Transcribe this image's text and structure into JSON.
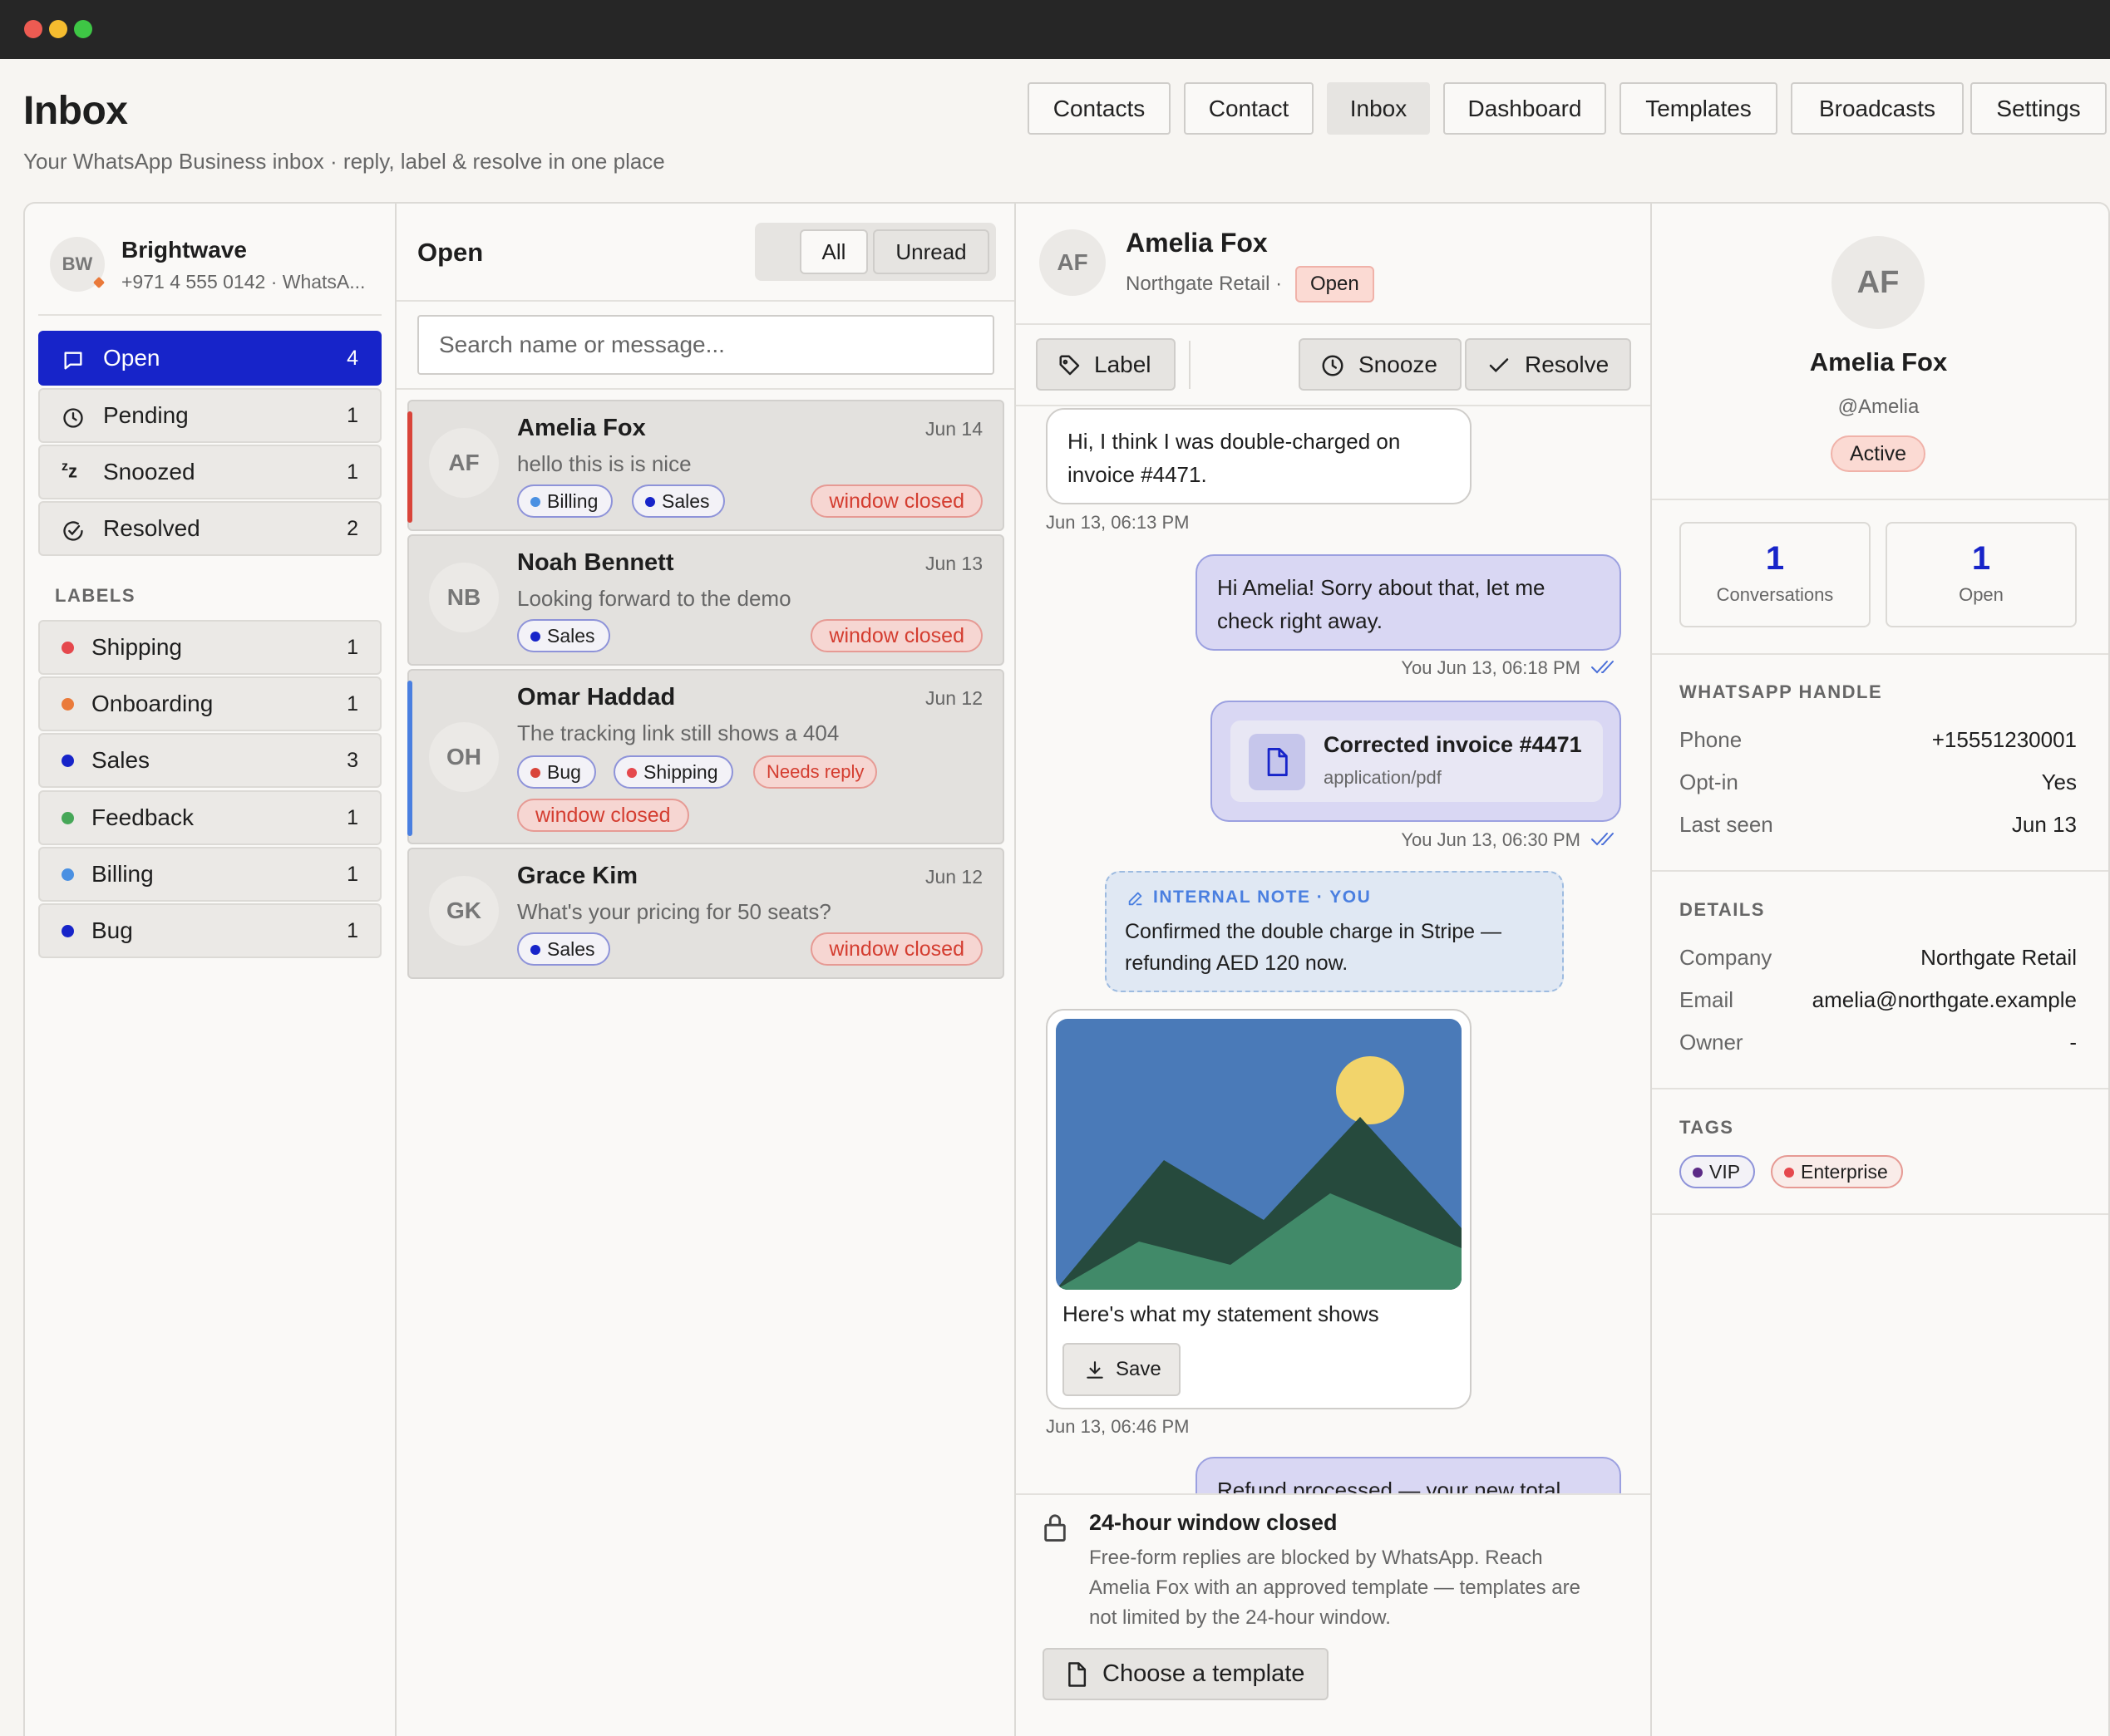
{
  "window": {
    "traffic": [
      "#ed5b52",
      "#f5bc2f",
      "#3ec645"
    ]
  },
  "header": {
    "title": "Inbox",
    "subtitle": "Your WhatsApp Business inbox · reply, label & resolve in one place",
    "nav": [
      "Contacts",
      "Contact",
      "Inbox",
      "Dashboard",
      "Templates",
      "Broadcasts",
      "Settings"
    ],
    "active_nav": "Inbox"
  },
  "account": {
    "initials": "BW",
    "name": "Brightwave",
    "phone": "+971 4 555 0142 · WhatsA..."
  },
  "sidebar": {
    "statuses": [
      {
        "label": "Open",
        "count": "4",
        "icon": "chat-bubble-icon"
      },
      {
        "label": "Pending",
        "count": "1",
        "icon": "clock-icon"
      },
      {
        "label": "Snoozed",
        "count": "1",
        "icon": "snooze-icon"
      },
      {
        "label": "Resolved",
        "count": "2",
        "icon": "check-circle-icon"
      }
    ],
    "labels_heading": "LABELS",
    "labels": [
      {
        "label": "Shipping",
        "count": "1",
        "color": "#e5484d"
      },
      {
        "label": "Onboarding",
        "count": "1",
        "color": "#ea7a3a"
      },
      {
        "label": "Sales",
        "count": "3",
        "color": "#1724c9"
      },
      {
        "label": "Feedback",
        "count": "1",
        "color": "#46a758"
      },
      {
        "label": "Billing",
        "count": "1",
        "color": "#4a90e2"
      },
      {
        "label": "Bug",
        "count": "1",
        "color": "#1724c9"
      }
    ]
  },
  "list": {
    "title": "Open",
    "filters": [
      "All",
      "Unread"
    ],
    "search_placeholder": "Search name or message...",
    "window_closed": "window closed",
    "needs_reply": "Needs reply",
    "conversations": [
      {
        "initials": "AF",
        "name": "Amelia Fox",
        "date": "Jun 14",
        "preview": "hello this is is nice",
        "tags": [
          "Billing",
          "Sales"
        ],
        "accent": "#d9443a"
      },
      {
        "initials": "NB",
        "name": "Noah Bennett",
        "date": "Jun 13",
        "preview": "Looking forward to the demo",
        "tags": [
          "Sales"
        ]
      },
      {
        "initials": "OH",
        "name": "Omar Haddad",
        "date": "Jun 12",
        "preview": "The tracking link still shows a 404",
        "tags": [
          "Bug",
          "Shipping"
        ],
        "accent": "#4a7fe0"
      },
      {
        "initials": "GK",
        "name": "Grace Kim",
        "date": "Jun 12",
        "preview": "What's your pricing for 50 seats?",
        "tags": [
          "Sales"
        ]
      }
    ]
  },
  "chat": {
    "initials": "AF",
    "name": "Amelia Fox",
    "company": "Northgate Retail ·",
    "status": "Open",
    "actions": {
      "label": "Label",
      "snooze": "Snooze",
      "resolve": "Resolve"
    },
    "messages": {
      "m1_line1": "Hi, I think I was double-charged on",
      "m1_line2": "invoice #4471.",
      "m1_time": "Jun 13, 06:13 PM",
      "m2_line1": "Hi Amelia! Sorry about that, let me",
      "m2_line2": "check right away.",
      "m2_meta": "You  Jun 13, 06:18 PM",
      "file_name": "Corrected invoice #4471",
      "file_type": "application/pdf",
      "m3_meta": "You  Jun 13, 06:30 PM",
      "note_header": "INTERNAL NOTE · YOU",
      "note_line1": "Confirmed the double charge in Stripe —",
      "note_line2": "refunding AED 120 now.",
      "image_caption": "Here's what my statement shows",
      "save_label": "Save",
      "m4_time": "Jun 13, 06:46 PM",
      "m5_partial": "Refund processed — your new total"
    },
    "window_closed": {
      "title": "24-hour window closed",
      "line1": "Free-form replies are blocked by WhatsApp. Reach",
      "line2": "Amelia Fox with an approved template — templates are",
      "line3": "not limited by the 24-hour window.",
      "button": "Choose a template"
    }
  },
  "contact": {
    "initials": "AF",
    "name": "Amelia Fox",
    "handle": "@Amelia",
    "status": "Active",
    "stats": [
      {
        "n": "1",
        "label": "Conversations"
      },
      {
        "n": "1",
        "label": "Open"
      }
    ],
    "whatsapp_heading": "WHATSAPP HANDLE",
    "whatsapp": [
      {
        "k": "Phone",
        "v": "+15551230001"
      },
      {
        "k": "Opt-in",
        "v": "Yes"
      },
      {
        "k": "Last seen",
        "v": "Jun 13"
      }
    ],
    "details_heading": "DETAILS",
    "details": [
      {
        "k": "Company",
        "v": "Northgate Retail"
      },
      {
        "k": "Email",
        "v": "amelia@northgate.example"
      },
      {
        "k": "Owner",
        "v": "-"
      }
    ],
    "tags_heading": "TAGS",
    "tags": [
      {
        "label": "VIP",
        "color": "#5b2a86"
      },
      {
        "label": "Enterprise",
        "color": "#e5484d"
      }
    ]
  }
}
